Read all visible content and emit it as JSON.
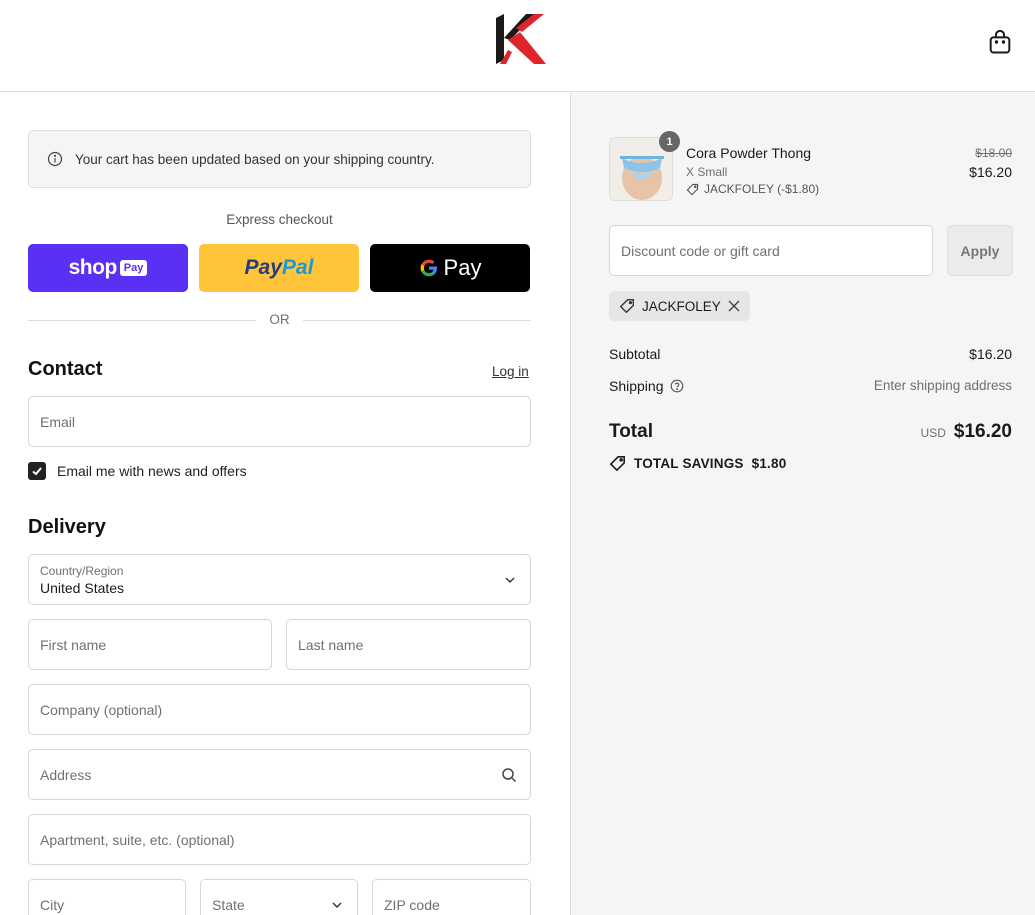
{
  "header": {
    "logo": "K-logo",
    "cart_icon": "shopping-bag-icon"
  },
  "banner": {
    "icon": "info-icon",
    "text": "Your cart has been updated based on your shipping country."
  },
  "express": {
    "label": "Express checkout",
    "shop_pay": "shop",
    "shop_pay_badge": "Pay",
    "paypal_part1": "Pay",
    "paypal_part2": "Pal",
    "gpay": "Pay",
    "or": "OR"
  },
  "contact": {
    "heading": "Contact",
    "login": "Log in",
    "email_placeholder": "Email",
    "newsletter_label": "Email me with news and offers",
    "newsletter_checked": true
  },
  "delivery": {
    "heading": "Delivery",
    "country_label": "Country/Region",
    "country_value": "United States",
    "first_name": "First name",
    "last_name": "Last name",
    "company": "Company (optional)",
    "address": "Address",
    "apartment": "Apartment, suite, etc. (optional)",
    "city": "City",
    "state": "State",
    "zip": "ZIP code"
  },
  "summary": {
    "item": {
      "quantity": "1",
      "name": "Cora Powder Thong",
      "variant": "X Small",
      "discount": "JACKFOLEY (-$1.80)",
      "price_original": "$18.00",
      "price_final": "$16.20"
    },
    "discount_placeholder": "Discount code or gift card",
    "apply": "Apply",
    "code_chip": "JACKFOLEY",
    "subtotal_label": "Subtotal",
    "subtotal_value": "$16.20",
    "shipping_label": "Shipping",
    "shipping_value": "Enter shipping address",
    "total_label": "Total",
    "currency": "USD",
    "total_value": "$16.20",
    "savings_label": "TOTAL SAVINGS",
    "savings_value": "$1.80"
  },
  "colors": {
    "shop_pay": "#5a31f4",
    "paypal": "#ffc439",
    "gpay": "#000000",
    "logo_red": "#e0242c",
    "summary_bg": "#f5f5f5"
  }
}
